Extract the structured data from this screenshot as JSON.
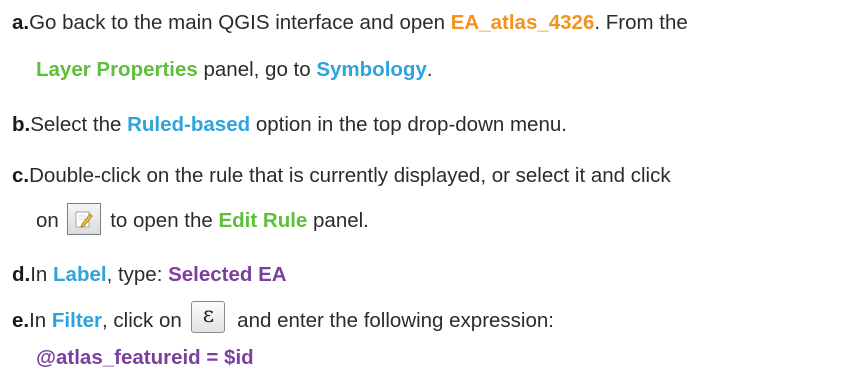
{
  "colors": {
    "orange": "#f4921e",
    "green": "#5fbf3a",
    "blue": "#2ea3dc",
    "purple": "#7b3fa0"
  },
  "steps": [
    {
      "letter": "a.",
      "t1": "Go back to the main QGIS interface and open ",
      "h1": "EA_atlas_4326",
      "t2": ". From the",
      "h2": "Layer Properties",
      "t3": " panel, go to ",
      "h3": "Symbology",
      "t4": "."
    },
    {
      "letter": "b.",
      "t1": "Select the ",
      "h1": "Ruled-based",
      "t2": " option in the top drop-down menu."
    },
    {
      "letter": "c.",
      "t1": "Double-click on the rule that is currently displayed, or select it and click",
      "t2": "on ",
      "icon": "edit-rule-icon",
      "t3": " to open the ",
      "h1": "Edit Rule",
      "t4": " panel."
    },
    {
      "letter": "d.",
      "t1": "In ",
      "h1": "Label",
      "t2": ", type: ",
      "h2": "Selected EA"
    },
    {
      "letter": "e.",
      "t1": "In ",
      "h1": "Filter",
      "t2": ", click on ",
      "icon": "expression-epsilon-icon",
      "icon_glyph": "ε",
      "t3": " and enter the following expression:",
      "h2": "@atlas_featureid = $id"
    }
  ]
}
